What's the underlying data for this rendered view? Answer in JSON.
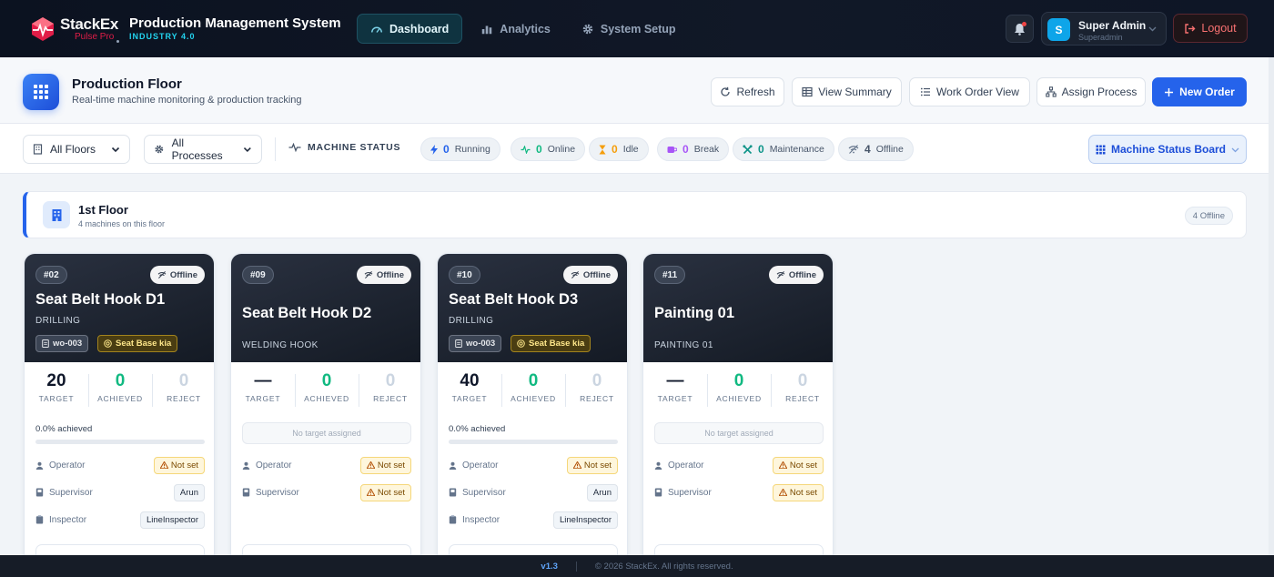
{
  "brand": {
    "name": "StackEx",
    "sub": "Pulse Pro"
  },
  "system": {
    "title": "Production Management System",
    "subtitle": "INDUSTRY 4.0"
  },
  "nav": {
    "tabs": [
      {
        "label": "Dashboard",
        "active": true
      },
      {
        "label": "Analytics"
      },
      {
        "label": "System Setup"
      }
    ]
  },
  "user": {
    "initial": "S",
    "name": "Super Admin",
    "role": "Superadmin",
    "logout_label": "Logout"
  },
  "header": {
    "title": "Production Floor",
    "subtitle": "Real-time machine monitoring & production tracking",
    "buttons": {
      "refresh": "Refresh",
      "summary": "View Summary",
      "work_order": "Work Order View",
      "assign": "Assign Process",
      "new_order": "New Order"
    }
  },
  "filters": {
    "floors": "All Floors",
    "processes": "All Processes"
  },
  "status": {
    "label": "MACHINE STATUS",
    "chips": [
      {
        "key": "running",
        "count": "0",
        "label": "Running",
        "color": "#2563eb"
      },
      {
        "key": "online",
        "count": "0",
        "label": "Online",
        "color": "#10b981"
      },
      {
        "key": "idle",
        "count": "0",
        "label": "Idle",
        "color": "#f59e0b"
      },
      {
        "key": "break",
        "count": "0",
        "label": "Break",
        "color": "#a855f7"
      },
      {
        "key": "maintenance",
        "count": "0",
        "label": "Maintenance",
        "color": "#0d9488"
      },
      {
        "key": "offline",
        "count": "4",
        "label": "Offline",
        "color": "#64748b"
      }
    ],
    "board_label": "Machine Status Board"
  },
  "floor": {
    "title": "1st Floor",
    "subtitle": "4 machines on this floor",
    "badge": "4 Offline"
  },
  "labels": {
    "target": "TARGET",
    "achieved": "ACHIEVED",
    "reject": "REJECT",
    "operator": "Operator",
    "supervisor": "Supervisor",
    "inspector": "Inspector",
    "no_target": "No target assigned"
  },
  "machines": [
    {
      "num": "#02",
      "status": "Offline",
      "name": "Seat Belt Hook D1",
      "process": "DRILLING",
      "wo": "wo-003",
      "part": "Seat Base kia",
      "target": "20",
      "achieved": "0",
      "reject": "0",
      "progress_text": "0.0% achieved",
      "progress": 0,
      "operator": "Not set",
      "supervisor": "Arun",
      "inspector": "LineInspector"
    },
    {
      "num": "#09",
      "status": "Offline",
      "name": "Seat Belt Hook D2",
      "process": "WELDING HOOK",
      "target": "—",
      "achieved": "0",
      "reject": "0",
      "operator": "Not set",
      "supervisor": "Not set"
    },
    {
      "num": "#10",
      "status": "Offline",
      "name": "Seat Belt Hook D3",
      "process": "DRILLING",
      "wo": "wo-003",
      "part": "Seat Base kia",
      "target": "40",
      "achieved": "0",
      "reject": "0",
      "progress_text": "0.0% achieved",
      "progress": 0,
      "operator": "Not set",
      "supervisor": "Arun",
      "inspector": "LineInspector"
    },
    {
      "num": "#11",
      "status": "Offline",
      "name": "Painting 01",
      "process": "PAINTING 01",
      "target": "—",
      "achieved": "0",
      "reject": "0",
      "operator": "Not set",
      "supervisor": "Not set"
    }
  ],
  "footer": {
    "version": "v1.3",
    "copyright": "© 2026 StackEx. All rights reserved."
  }
}
